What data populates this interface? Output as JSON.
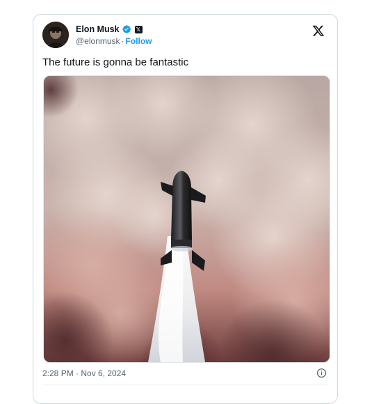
{
  "author": {
    "display_name": "Elon Musk",
    "handle": "@elonmusk",
    "follow_label": "Follow",
    "separator": "·"
  },
  "tweet": {
    "text": "The future is gonna be fantastic",
    "timestamp": "2:28 PM · Nov 6, 2024"
  },
  "icons": {
    "verified": "verified-badge-icon",
    "affiliation": "x-affiliate-badge-icon",
    "brand": "x-logo-icon",
    "info": "info-icon"
  },
  "colors": {
    "accent": "#1d9bf0",
    "text": "#0f1419",
    "muted": "#536471",
    "border": "#cfd9de"
  }
}
